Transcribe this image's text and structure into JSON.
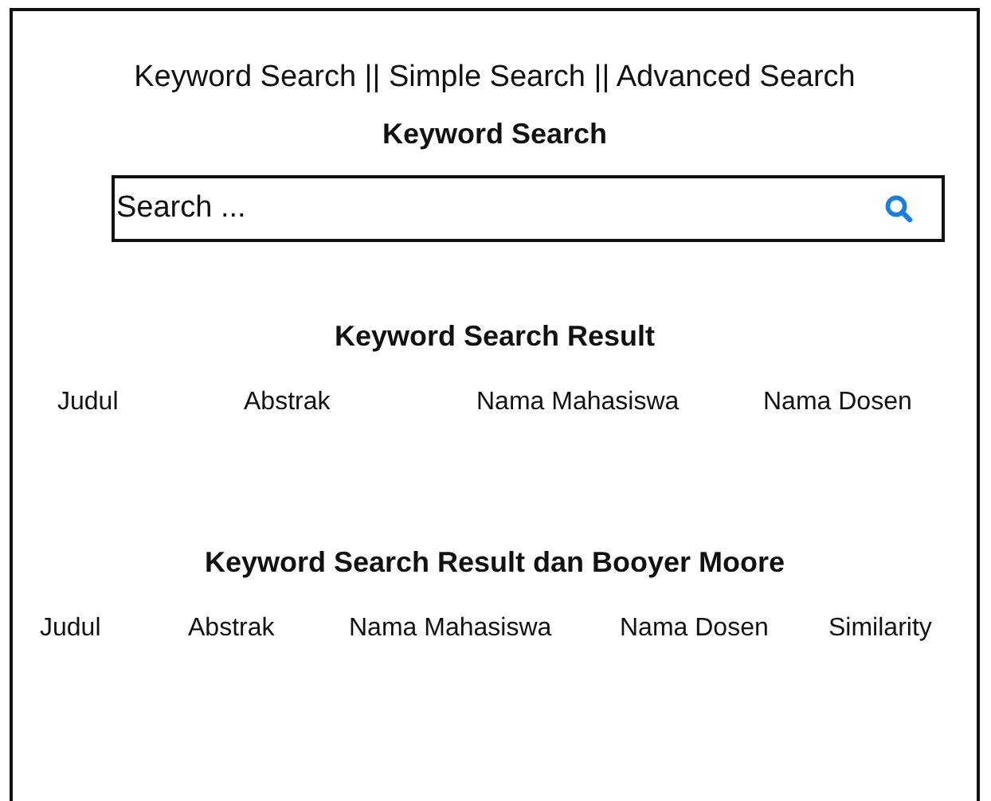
{
  "nav": "Keyword Search || Simple Search || Advanced Search",
  "title": "Keyword Search",
  "search": {
    "placeholder": "Search ..."
  },
  "results": [
    {
      "heading": "Keyword Search Result",
      "columns": [
        "Judul",
        "Abstrak",
        "Nama Mahasiswa",
        "Nama Dosen"
      ]
    },
    {
      "heading": "Keyword Search Result dan Booyer Moore",
      "columns": [
        "Judul",
        "Abstrak",
        "Nama Mahasiswa",
        "Nama Dosen",
        "Similarity"
      ]
    }
  ]
}
